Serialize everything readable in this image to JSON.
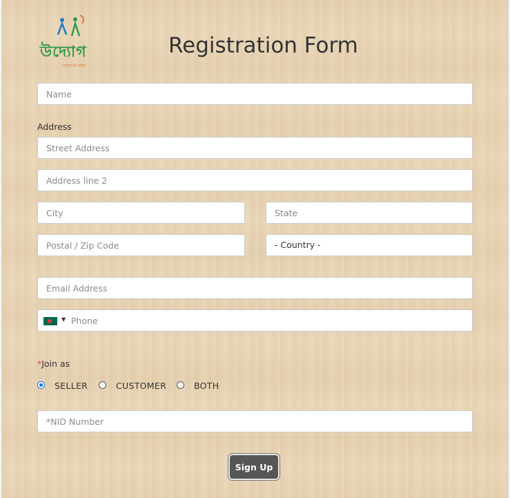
{
  "logo": {
    "text": "উদ্যোগ",
    "subtitle": "আমাদের লক্ষ্য"
  },
  "form": {
    "title": "Registration Form",
    "name_placeholder": "Name",
    "address_label": "Address",
    "street_placeholder": "Street Address",
    "line2_placeholder": "Address line 2",
    "city_placeholder": "City",
    "state_placeholder": "State",
    "zip_placeholder": "Postal / Zip Code",
    "country_value": "- Country -",
    "email_placeholder": "Email Address",
    "phone_placeholder": "Phone",
    "phone_flag": "bangladesh-flag-icon",
    "join_required_mark": "*",
    "join_label": "Join as",
    "join_options": [
      "SELLER",
      "CUSTOMER",
      "BOTH"
    ],
    "join_selected": "SELLER",
    "nid_placeholder": "*NID Number",
    "submit_label": "Sign Up"
  },
  "colors": {
    "accent": "#1a73e8",
    "button": "#565656",
    "background": "#e9d6b7",
    "logo_green": "#2c9a45",
    "required": "#d9534f"
  }
}
